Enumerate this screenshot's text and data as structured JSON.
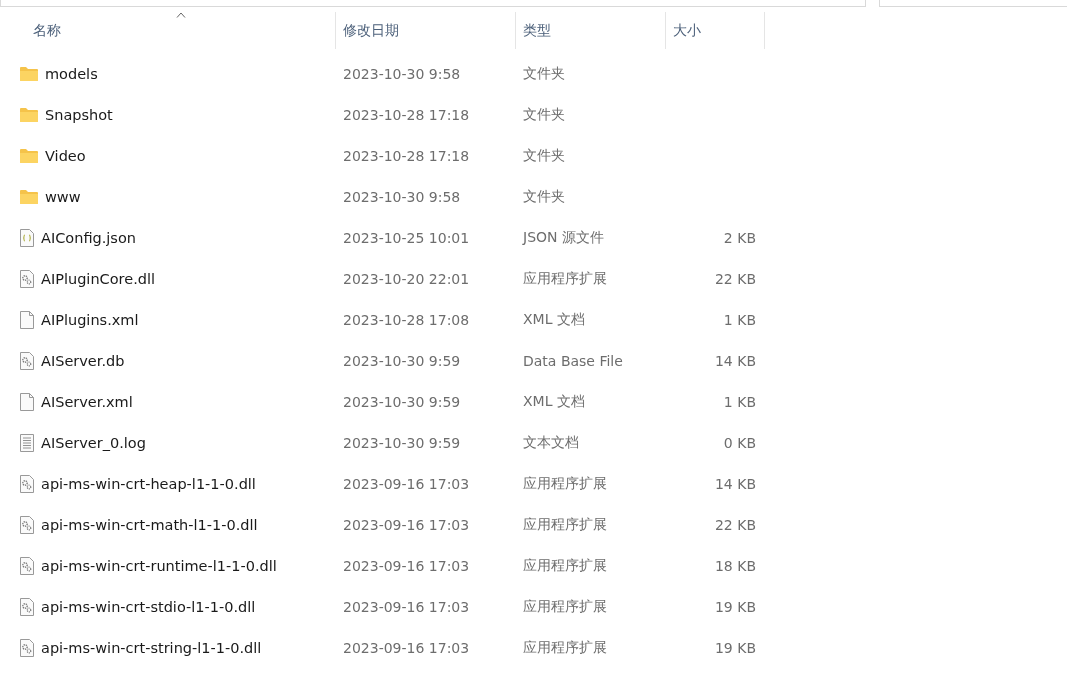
{
  "columns": [
    {
      "label": "名称",
      "sorted": true
    },
    {
      "label": "修改日期",
      "sorted": false
    },
    {
      "label": "类型",
      "sorted": false
    },
    {
      "label": "大小",
      "sorted": false
    }
  ],
  "rows": [
    {
      "kind": "folder",
      "name": "models",
      "date": "2023-10-30 9:58",
      "type": "文件夹"
    },
    {
      "kind": "folder",
      "name": "Snapshot",
      "date": "2023-10-28 17:18",
      "type": "文件夹"
    },
    {
      "kind": "folder",
      "name": "Video",
      "date": "2023-10-28 17:18",
      "type": "文件夹"
    },
    {
      "kind": "folder",
      "name": "www",
      "date": "2023-10-30 9:58",
      "type": "文件夹"
    },
    {
      "kind": "json",
      "name": "AIConfig.json",
      "date": "2023-10-25 10:01",
      "type": "JSON 源文件",
      "size": "2 KB"
    },
    {
      "kind": "dll",
      "name": "AIPluginCore.dll",
      "date": "2023-10-20 22:01",
      "type": "应用程序扩展",
      "size": "22 KB"
    },
    {
      "kind": "file",
      "name": "AIPlugins.xml",
      "date": "2023-10-28 17:08",
      "type": "XML 文档",
      "size": "1 KB"
    },
    {
      "kind": "dll",
      "name": "AIServer.db",
      "date": "2023-10-30 9:59",
      "type": "Data Base File",
      "size": "14 KB"
    },
    {
      "kind": "file",
      "name": "AIServer.xml",
      "date": "2023-10-30 9:59",
      "type": "XML 文档",
      "size": "1 KB"
    },
    {
      "kind": "log",
      "name": "AIServer_0.log",
      "date": "2023-10-30 9:59",
      "type": "文本文档",
      "size": "0 KB"
    },
    {
      "kind": "dll",
      "name": "api-ms-win-crt-heap-l1-1-0.dll",
      "date": "2023-09-16 17:03",
      "type": "应用程序扩展",
      "size": "14 KB"
    },
    {
      "kind": "dll",
      "name": "api-ms-win-crt-math-l1-1-0.dll",
      "date": "2023-09-16 17:03",
      "type": "应用程序扩展",
      "size": "22 KB"
    },
    {
      "kind": "dll",
      "name": "api-ms-win-crt-runtime-l1-1-0.dll",
      "date": "2023-09-16 17:03",
      "type": "应用程序扩展",
      "size": "18 KB"
    },
    {
      "kind": "dll",
      "name": "api-ms-win-crt-stdio-l1-1-0.dll",
      "date": "2023-09-16 17:03",
      "type": "应用程序扩展",
      "size": "19 KB"
    },
    {
      "kind": "dll",
      "name": "api-ms-win-crt-string-l1-1-0.dll",
      "date": "2023-09-16 17:03",
      "type": "应用程序扩展",
      "size": "19 KB"
    }
  ]
}
